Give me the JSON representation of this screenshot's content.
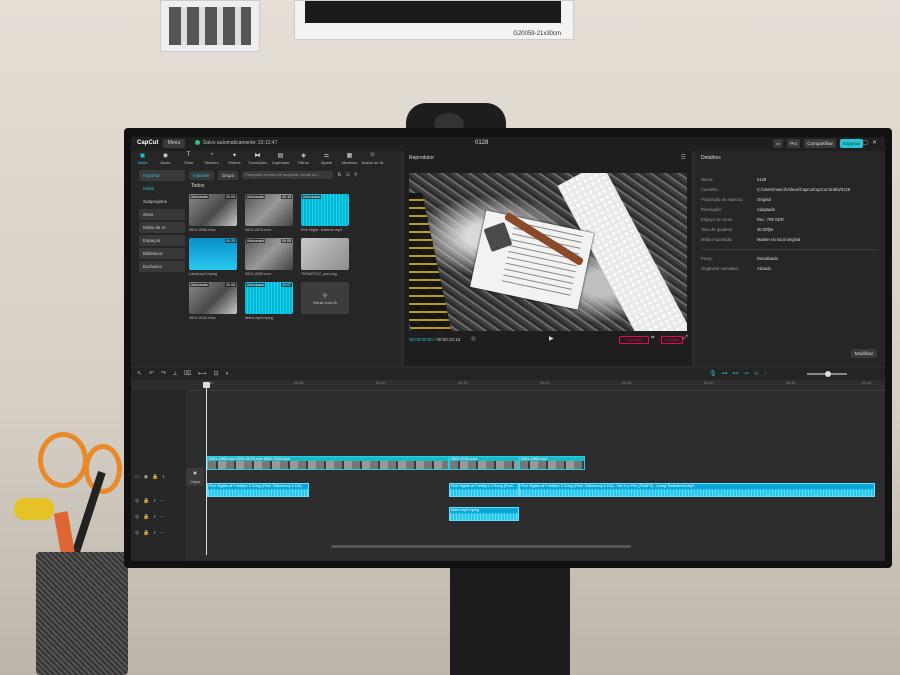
{
  "top": {
    "logo": "CapCut",
    "menu": "Menu",
    "save_status": "Salvo automaticamente: 23:12:47",
    "project_title": "0128",
    "pro": "Pro",
    "share": "Compartilhar",
    "export": "Exportar"
  },
  "toolbar": {
    "items": [
      {
        "icon": "media-icon",
        "label": "Mídia"
      },
      {
        "icon": "audio-icon",
        "label": "Áudio"
      },
      {
        "icon": "text-icon",
        "label": "Texto"
      },
      {
        "icon": "sticker-icon",
        "label": "Stickers"
      },
      {
        "icon": "effects-icon",
        "label": "Efeitos"
      },
      {
        "icon": "transitions-icon",
        "label": "Transições"
      },
      {
        "icon": "captions-icon",
        "label": "Legendas"
      },
      {
        "icon": "filters-icon",
        "label": "Filtros"
      },
      {
        "icon": "adjust-icon",
        "label": "Ajuste"
      },
      {
        "icon": "templates-icon",
        "label": "Modelos"
      },
      {
        "icon": "ai-avatar-icon",
        "label": "Avatar de IA"
      }
    ]
  },
  "sidebar": {
    "items": [
      "Importar",
      "Mídia",
      "Subprojetos",
      "Seus",
      "Mídia de IA",
      "Espaços",
      "Biblioteca",
      "Exclusivo"
    ]
  },
  "media": {
    "import": "Importar",
    "group": "Grupo",
    "search_placeholder": "Pesquisar nomes de arquivos, cenas ou...",
    "all": "Todos",
    "added": "Adicionado",
    "items": [
      {
        "name": "0001-0065.mov",
        "duration": "00:09"
      },
      {
        "name": "0001-0076.mov",
        "duration": "00:18"
      },
      {
        "name": "Five Night...tledone.mp3",
        "duration": ""
      },
      {
        "name": "Lamy.mp3.mpeg",
        "duration": "00:20"
      },
      {
        "name": "0001-0200.mov",
        "duration": "00:08"
      },
      {
        "name": "7f03a57247_axe.png",
        "duration": ""
      },
      {
        "name": "0001-0100.mov",
        "duration": "00:08"
      },
      {
        "name": "listen.mp3.mpeg",
        "duration": "00:07"
      }
    ],
    "ai_tile": "Gerar com IA"
  },
  "player": {
    "title": "Reprodutor",
    "timecode": "00:00:00:00",
    "total": "00:00:22:15",
    "ratio_btn": "Proporção",
    "full_btn": "Completo"
  },
  "details": {
    "title": "Detalhes",
    "rows": [
      {
        "k": "Nome:",
        "v": "0128"
      },
      {
        "k": "Caminho:",
        "v": "C:/Users/marci/Videos/CapcutCapCut Drafts/0128"
      },
      {
        "k": "Proporção de aspecto:",
        "v": "Original"
      },
      {
        "k": "Resolução:",
        "v": "Adaptado"
      },
      {
        "k": "Espaço de cores:",
        "v": "Rec. 709 SDR"
      },
      {
        "k": "Taxa de quadros:",
        "v": "30.00fps"
      },
      {
        "k": "Mídia importada:",
        "v": "Manter no local original"
      }
    ],
    "rows2": [
      {
        "k": "Proxy:",
        "v": "Desativado"
      },
      {
        "k": "Organizar camadas:",
        "v": "Ativado"
      }
    ],
    "modify": "Modificar"
  },
  "timeline": {
    "ticks": [
      "00:00",
      "00:05",
      "00:10",
      "00:15",
      "00:20",
      "00:25",
      "00:30",
      "00:35",
      "00:40"
    ],
    "cover": "Capa",
    "video_clips": [
      "0001-0065.mov",
      "0001-0076.mov",
      "0001-0200.mov",
      "0001-0100.mov",
      "0001-0065.mov"
    ],
    "audio_clips": [
      "Five Nights at Freddy's 3 Song (Feat. Dikkkonny & DA)",
      "Five Nights at Freddy's 3 Song (Feat. ...",
      "Five Nights at Freddy's 3 Song (Feat. Dikkkonny & DA) - Die in a Fire (FNAF3) - Living Tombstone.mp3",
      "listen.mp3.mpeg"
    ]
  },
  "colors": {
    "accent": "#27c3d6",
    "bg": "#2b2b2b"
  }
}
